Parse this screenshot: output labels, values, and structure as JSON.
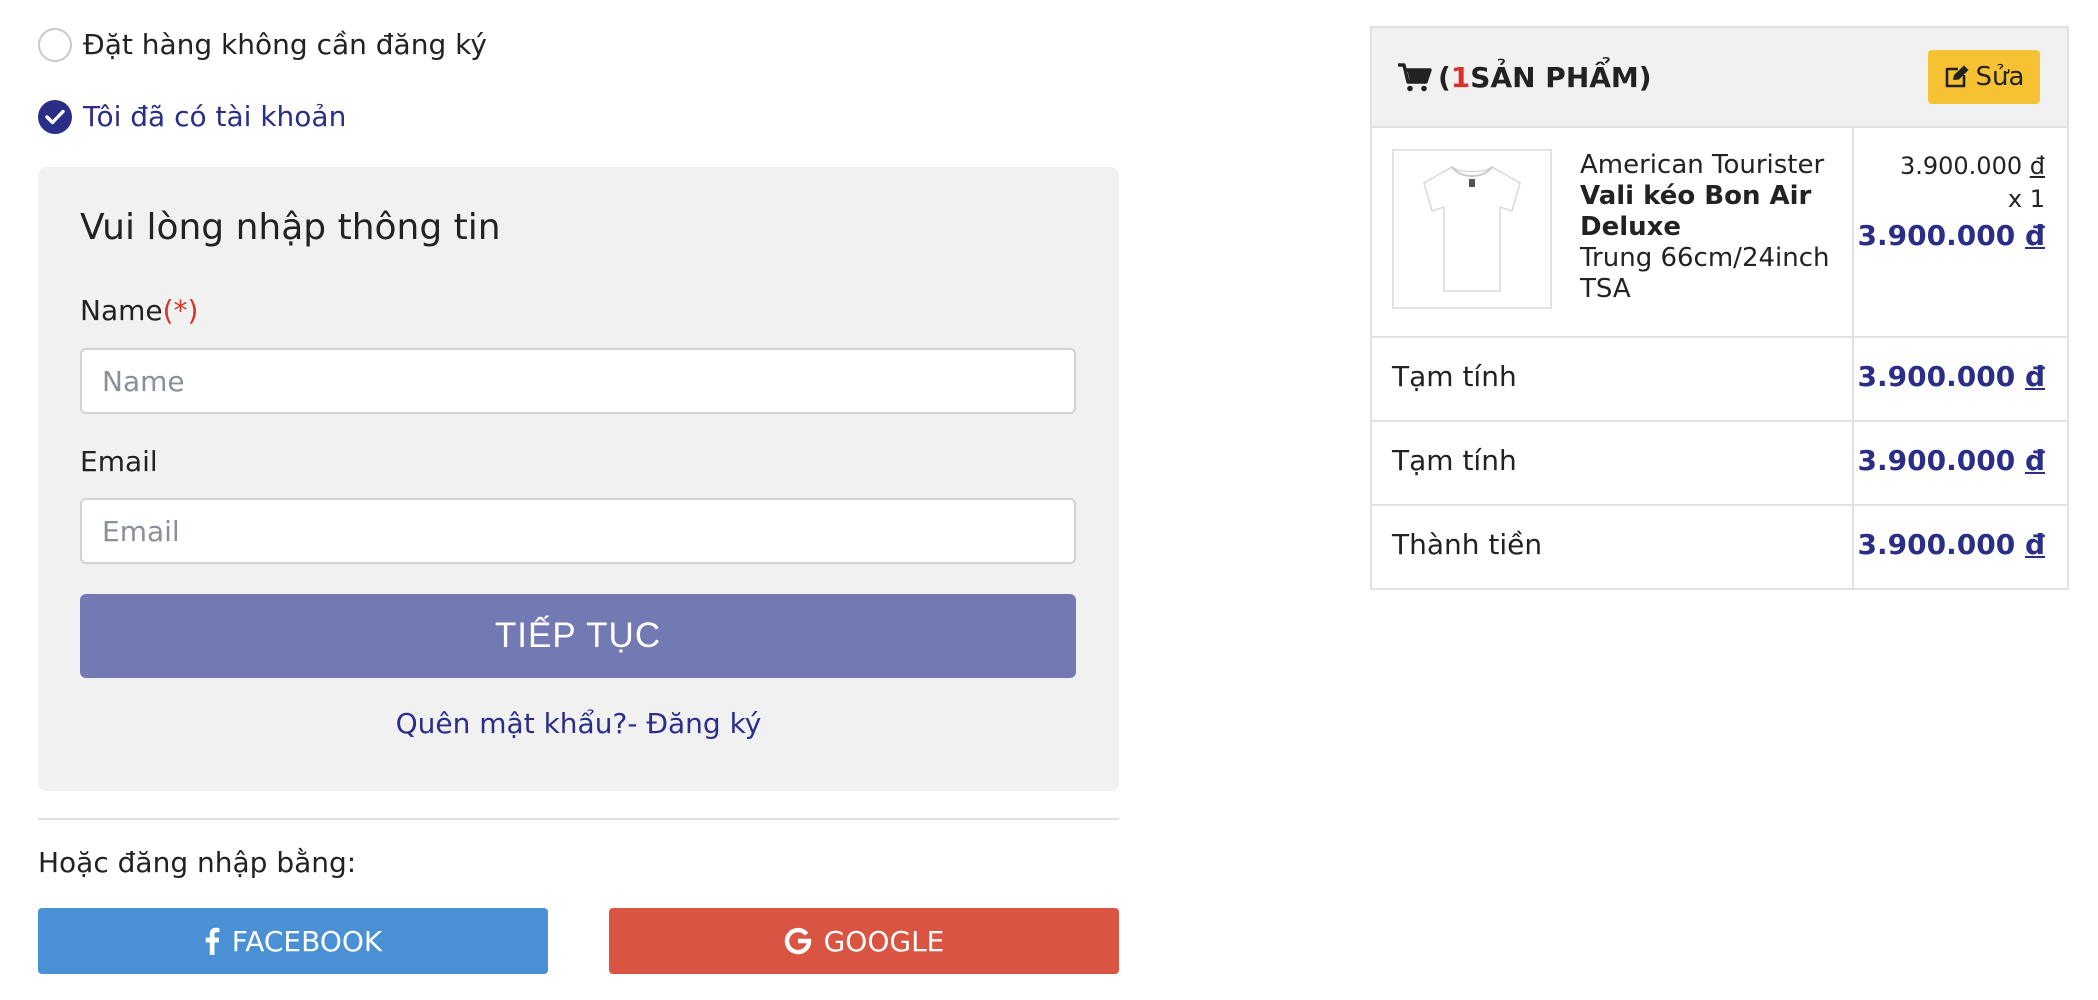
{
  "checkout_options": {
    "guest_label": "Đặt hàng không cần đăng ký",
    "member_label": "Tôi đã có tài khoản"
  },
  "login_form": {
    "title": "Vui lòng nhập thông tin",
    "name_label": "Name",
    "required_mark": "(*)",
    "name_placeholder": "Name",
    "email_label": "Email",
    "email_placeholder": "Email",
    "continue_label": "TIẾP TỤC",
    "forgot_password": "Quên mật khẩu?",
    "register_link": "- Đăng ký"
  },
  "social_login": {
    "prompt": "Hoặc đăng nhập bằng:",
    "facebook_label": "FACEBOOK",
    "google_label": "GOOGLE"
  },
  "cart": {
    "open_paren": "(",
    "item_count": "1",
    "count_suffix": " SẢN PHẨM)",
    "edit_label": "Sửa",
    "item": {
      "brand": "American Tourister",
      "name": "Vali kéo Bon Air Deluxe",
      "variant": "Trung 66cm/24inch TSA",
      "unit_price": "3.900.000",
      "quantity": "x 1",
      "line_total": "3.900.000",
      "currency": "đ"
    },
    "summary": [
      {
        "label": "Tạm tính",
        "value": "3.900.000"
      },
      {
        "label": "Tạm tính",
        "value": "3.900.000"
      },
      {
        "label": "Thành tiền",
        "value": "3.900.000"
      }
    ]
  },
  "colors": {
    "primary": "#2b2e86",
    "continue_button": "#7379b3",
    "facebook": "#4a90d4",
    "google": "#d95441",
    "edit_button": "#f6c233",
    "required": "#d9322d"
  },
  "icons": {
    "cart": "shopping-cart-icon",
    "edit": "edit-icon",
    "facebook": "facebook-icon",
    "google": "google-icon",
    "check": "check-circle-icon",
    "product": "tshirt-image"
  }
}
